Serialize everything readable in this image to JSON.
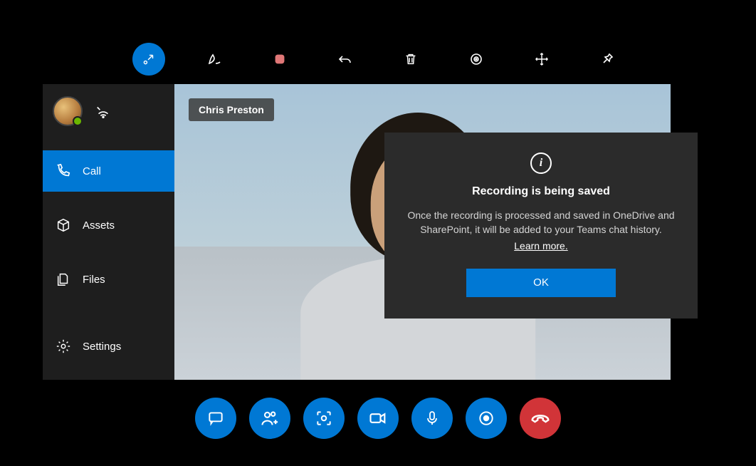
{
  "participant_name": "Chris Preston",
  "sidebar": {
    "items": [
      {
        "label": "Call"
      },
      {
        "label": "Assets"
      },
      {
        "label": "Files"
      },
      {
        "label": "Settings"
      }
    ]
  },
  "modal": {
    "title": "Recording is being saved",
    "body": "Once the recording is processed and saved in OneDrive and SharePoint, it will be added to your Teams chat history.",
    "learn_more": "Learn more.",
    "ok_label": "OK"
  },
  "colors": {
    "accent": "#0078d4",
    "hangup": "#d13438",
    "panel": "#2b2b2b",
    "sidebar": "#1e1e1e"
  }
}
